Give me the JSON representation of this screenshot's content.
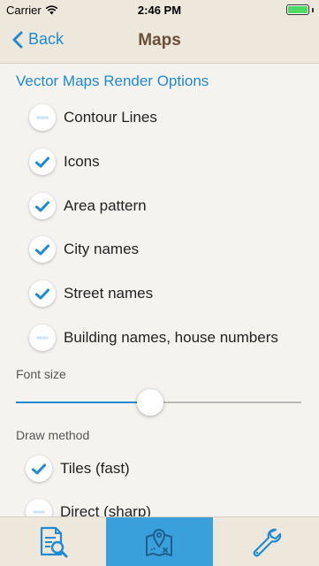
{
  "status_bar": {
    "carrier": "Carrier",
    "time": "2:46 PM",
    "battery_level": 1.0
  },
  "nav": {
    "back_label": "Back",
    "title": "Maps"
  },
  "section": {
    "title": "Vector Maps Render Options"
  },
  "options": [
    {
      "label": "Contour Lines",
      "checked": false
    },
    {
      "label": "Icons",
      "checked": true
    },
    {
      "label": "Area pattern",
      "checked": true
    },
    {
      "label": "City names",
      "checked": true
    },
    {
      "label": "Street names",
      "checked": true
    },
    {
      "label": "Building names, house numbers",
      "checked": false
    }
  ],
  "font_size": {
    "label": "Font size",
    "value": 0.47
  },
  "draw_method": {
    "label": "Draw method",
    "options": [
      {
        "label": "Tiles (fast)",
        "checked": true
      },
      {
        "label": "Direct (sharp)",
        "checked": false
      }
    ]
  },
  "tabs": [
    {
      "name": "document-search-icon",
      "active": false
    },
    {
      "name": "map-pin-icon",
      "active": true
    },
    {
      "name": "wrench-icon",
      "active": false
    }
  ],
  "colors": {
    "accent": "#1f8ad2",
    "title_brown": "#6a4e35",
    "bar_background": "#eee8dc",
    "active_tab": "#3aa0db",
    "battery_green": "#4cd964"
  }
}
